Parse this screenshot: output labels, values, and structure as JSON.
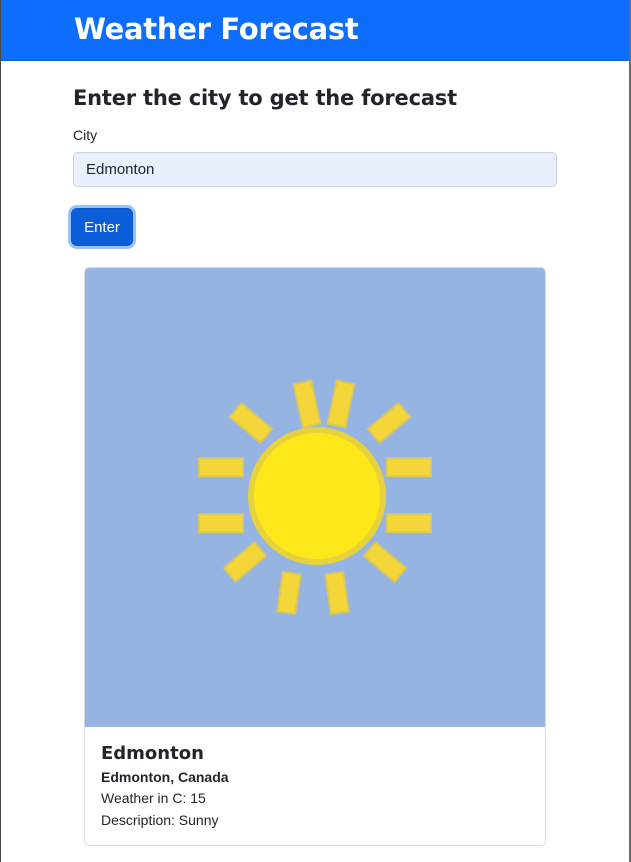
{
  "header": {
    "title": "Weather Forecast"
  },
  "form": {
    "heading": "Enter the city to get the forecast",
    "city_label": "City",
    "city_value": "Edmonton",
    "submit_label": "Enter"
  },
  "result": {
    "icon": "sun-icon",
    "title": "Edmonton",
    "subtitle": "Edmonton, Canada",
    "temperature_label": "Weather in C: 15",
    "description_label": "Description: Sunny"
  },
  "colors": {
    "navbar": "#0d6efd",
    "button": "#0b5ed7",
    "image_background": "#96b4e2",
    "sun_fill": "#ffe81a",
    "sun_rays": "#f5d63a"
  }
}
